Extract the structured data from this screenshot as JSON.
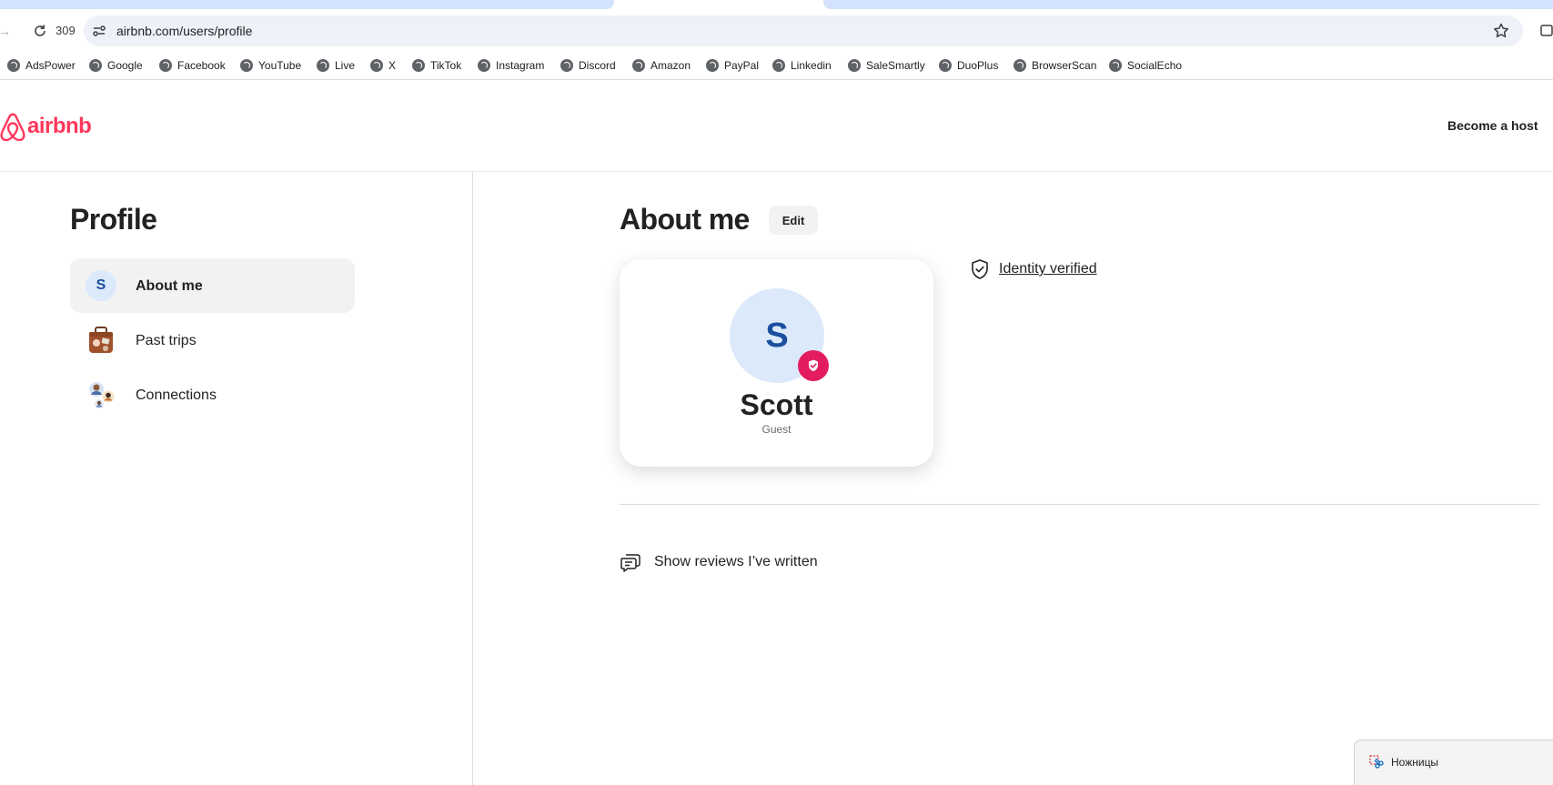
{
  "browser": {
    "reload_counter": "309",
    "url": "airbnb.com/users/profile",
    "bookmarks": [
      "AdsPower",
      "Google",
      "Facebook",
      "YouTube",
      "Live",
      "X",
      "TikTok",
      "Instagram",
      "Discord",
      "Amazon",
      "PayPal",
      "Linkedin",
      "SaleSmartly",
      "DuoPlus",
      "BrowserScan",
      "SocialEcho"
    ]
  },
  "header": {
    "logo_text": "airbnb",
    "host_link": "Become a host",
    "brand_color": "#FF385C"
  },
  "sidebar": {
    "heading": "Profile",
    "items": [
      {
        "label": "About me",
        "avatar_letter": "S",
        "active": true
      },
      {
        "label": "Past trips",
        "icon": "suitcase-icon"
      },
      {
        "label": "Connections",
        "icon": "people-icon"
      }
    ]
  },
  "main": {
    "heading": "About me",
    "edit_label": "Edit",
    "card": {
      "avatar_letter": "S",
      "name": "Scott",
      "role": "Guest",
      "badge": "verified-badge-icon"
    },
    "identity_link": "Identity verified",
    "reviews_link": "Show reviews I’ve written"
  },
  "snipping_tool": {
    "label": "Ножницы"
  }
}
